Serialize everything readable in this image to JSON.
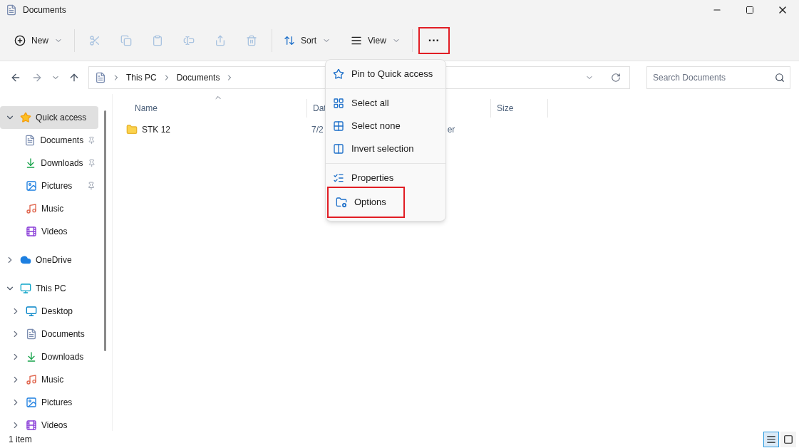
{
  "window": {
    "title": "Documents"
  },
  "toolbar": {
    "new": {
      "label": "New"
    },
    "edit_actions": [
      {
        "disabled": true
      },
      {
        "disabled": true
      },
      {
        "disabled": true
      },
      {
        "disabled": true
      },
      {
        "disabled": true
      },
      {
        "disabled": true
      }
    ],
    "sort": {
      "label": "Sort"
    },
    "view": {
      "label": "View"
    },
    "more": {
      "label": "···",
      "highlighted": true
    }
  },
  "address_bar": {
    "breadcrumbs": [
      "This PC",
      "Documents"
    ]
  },
  "search": {
    "placeholder": "Search Documents"
  },
  "sidebar": {
    "items": [
      {
        "label": "Quick access",
        "kind": "star",
        "expanded": true,
        "selected": true,
        "children": [
          {
            "label": "Documents",
            "kind": "documents",
            "pinned": true,
            "selected": false
          },
          {
            "label": "Downloads",
            "kind": "downloads",
            "pinned": true,
            "selected": false
          },
          {
            "label": "Pictures",
            "kind": "pictures",
            "pinned": true,
            "selected": false
          },
          {
            "label": "Music",
            "kind": "music",
            "pinned": false,
            "selected": false
          },
          {
            "label": "Videos",
            "kind": "videos",
            "pinned": false,
            "selected": false
          }
        ]
      },
      {
        "label": "OneDrive",
        "kind": "cloud",
        "expanded": false,
        "selected": false
      },
      {
        "label": "This PC",
        "kind": "pc",
        "expanded": true,
        "selected": false,
        "children": [
          {
            "label": "Desktop",
            "kind": "desktop",
            "expanded": false,
            "selected": false
          },
          {
            "label": "Documents",
            "kind": "documents",
            "expanded": false,
            "selected": false
          },
          {
            "label": "Downloads",
            "kind": "downloads",
            "expanded": false,
            "selected": false
          },
          {
            "label": "Music",
            "kind": "music",
            "expanded": false,
            "selected": false
          },
          {
            "label": "Pictures",
            "kind": "pictures",
            "expanded": false,
            "selected": false
          },
          {
            "label": "Videos",
            "kind": "videos",
            "expanded": false,
            "selected": false
          }
        ]
      }
    ]
  },
  "table": {
    "columns": [
      {
        "label": "Name",
        "sorted": true
      },
      {
        "label": "Dat",
        "sorted": false
      },
      {
        "label": "Size",
        "sorted": false
      }
    ],
    "rows": [
      {
        "name": "STK 12",
        "date": "7/2",
        "type": "er"
      }
    ]
  },
  "context_menu": {
    "groups": [
      [
        {
          "label": "Pin to Quick access",
          "highlighted": false
        }
      ],
      [
        {
          "label": "Select all",
          "highlighted": false
        },
        {
          "label": "Select none",
          "highlighted": false
        },
        {
          "label": "Invert selection",
          "highlighted": false
        }
      ],
      [
        {
          "label": "Properties",
          "highlighted": false
        },
        {
          "label": "Options",
          "highlighted": true
        }
      ]
    ]
  },
  "status_bar": {
    "text": "1 item",
    "view_modes": [
      {
        "selected": true
      },
      {
        "selected": false
      }
    ]
  }
}
